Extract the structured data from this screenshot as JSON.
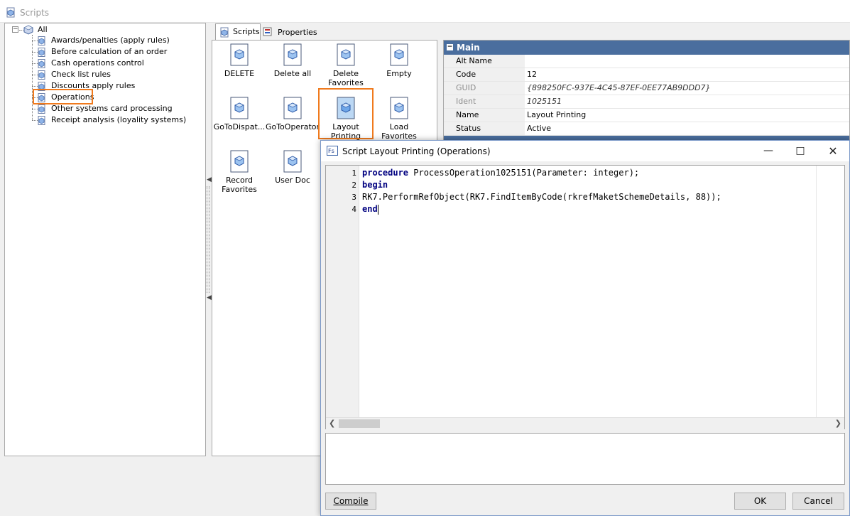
{
  "window": {
    "title": "Scripts"
  },
  "tree": {
    "root_label": "All",
    "items": [
      {
        "label": "Awards/penalties (apply rules)"
      },
      {
        "label": "Before calculation of an order"
      },
      {
        "label": "Cash operations control"
      },
      {
        "label": "Check list rules"
      },
      {
        "label": "Discounts apply rules"
      },
      {
        "label": "Operations",
        "selected": true
      },
      {
        "label": "Other systems card processing"
      },
      {
        "label": "Receipt analysis (loyality systems)"
      }
    ]
  },
  "tabs": [
    {
      "label": "Scripts",
      "active": true
    },
    {
      "label": "Properties",
      "active": false
    }
  ],
  "scripts": [
    {
      "label": "DELETE"
    },
    {
      "label": "Delete all"
    },
    {
      "label": "Delete Favorites"
    },
    {
      "label": "Empty"
    },
    {
      "label": "GoToDispat..."
    },
    {
      "label": "GoToOperator"
    },
    {
      "label": "Layout Printing",
      "selected": true
    },
    {
      "label": "Load Favorites"
    },
    {
      "label": "Record Favorites"
    },
    {
      "label": "User Doc"
    }
  ],
  "properties": {
    "section": "Main",
    "rows": [
      {
        "name": "Alt Name",
        "value": ""
      },
      {
        "name": "Code",
        "value": "12"
      },
      {
        "name": "GUID",
        "value": "{898250FC-937E-4C45-87EF-0EE77AB9DDD7}",
        "disabled": true
      },
      {
        "name": "Ident",
        "value": "1025151",
        "disabled": true
      },
      {
        "name": "Name",
        "value": "Layout Printing"
      },
      {
        "name": "Status",
        "value": "Active"
      }
    ]
  },
  "dialog": {
    "title": "Script Layout Printing (Operations)",
    "icon_text": "Fs",
    "code_lines": [
      {
        "num": "1",
        "kw": "procedure",
        "rest": " ProcessOperation1025151(Parameter: integer);"
      },
      {
        "num": "2",
        "kw": "begin",
        "rest": ""
      },
      {
        "num": "3",
        "kw": "",
        "rest": "RK7.PerformRefObject(RK7.FindItemByCode(rkrefMaketSchemeDetails, 88));"
      },
      {
        "num": "4",
        "kw": "end",
        "rest": ""
      }
    ],
    "compile_label": "Compile",
    "ok_label": "OK",
    "cancel_label": "Cancel"
  },
  "colors": {
    "highlight": "#f07a1d",
    "header": "#4a6e9e",
    "keyword": "#000080"
  }
}
